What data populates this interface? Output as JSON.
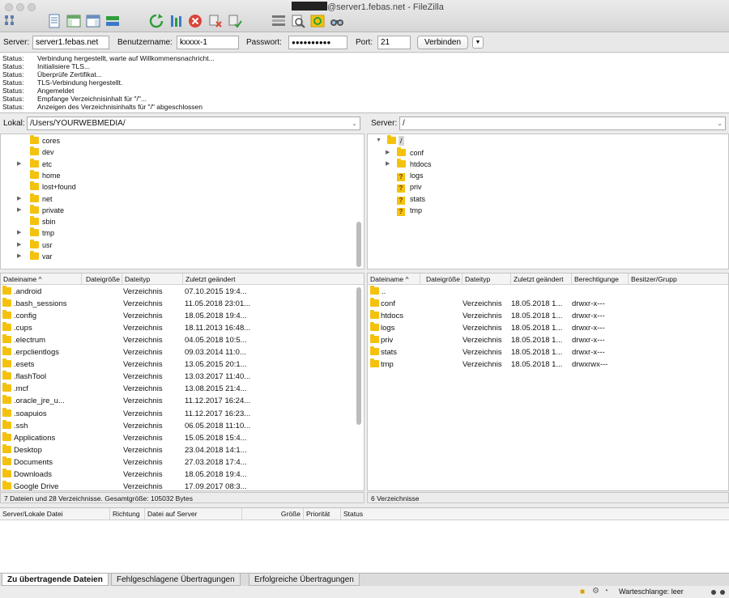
{
  "window": {
    "title_suffix": "@server1.febas.net - FileZilla"
  },
  "quickconnect": {
    "server_label": "Server:",
    "server_value": "server1.febas.net",
    "user_label": "Benutzername:",
    "user_value": "kxxxx-1",
    "pass_label": "Passwort:",
    "pass_value": "●●●●●●●●●●",
    "port_label": "Port:",
    "port_value": "21",
    "connect_label": "Verbinden",
    "dropdown_glyph": "▼"
  },
  "log": [
    {
      "key": "Status:",
      "msg": "Verbindung hergestellt, warte auf Willkommensnachricht..."
    },
    {
      "key": "Status:",
      "msg": "Initialisiere TLS..."
    },
    {
      "key": "Status:",
      "msg": "Überprüfe Zertifikat..."
    },
    {
      "key": "Status:",
      "msg": "TLS-Verbindung hergestellt."
    },
    {
      "key": "Status:",
      "msg": "Angemeldet"
    },
    {
      "key": "Status:",
      "msg": "Empfange Verzeichnisinhalt für \"/\"..."
    },
    {
      "key": "Status:",
      "msg": "Anzeigen des Verzeichnisinhalts für \"/\" abgeschlossen"
    }
  ],
  "local": {
    "path_label": "Lokal:",
    "path_value": "/Users/YOURWEBMEDIA/",
    "tree": [
      {
        "name": "cores",
        "arrow": false
      },
      {
        "name": "dev",
        "arrow": false
      },
      {
        "name": "etc",
        "arrow": true
      },
      {
        "name": "home",
        "arrow": false
      },
      {
        "name": "lost+found",
        "arrow": false
      },
      {
        "name": "net",
        "arrow": true
      },
      {
        "name": "private",
        "arrow": true
      },
      {
        "name": "sbin",
        "arrow": false
      },
      {
        "name": "tmp",
        "arrow": true
      },
      {
        "name": "usr",
        "arrow": true
      },
      {
        "name": "var",
        "arrow": true
      }
    ],
    "columns": [
      "Dateiname",
      "Dateigröße",
      "Dateityp",
      "Zuletzt geändert"
    ],
    "sort_glyph": "^",
    "rows": [
      {
        "name": ".android",
        "type": "Verzeichnis",
        "date": "07.10.2015 19:4..."
      },
      {
        "name": ".bash_sessions",
        "type": "Verzeichnis",
        "date": "11.05.2018 23:01..."
      },
      {
        "name": ".config",
        "type": "Verzeichnis",
        "date": "18.05.2018 19:4..."
      },
      {
        "name": ".cups",
        "type": "Verzeichnis",
        "date": "18.11.2013 16:48..."
      },
      {
        "name": ".electrum",
        "type": "Verzeichnis",
        "date": "04.05.2018 10:5..."
      },
      {
        "name": ".erpclientlogs",
        "type": "Verzeichnis",
        "date": "09.03.2014 11:0..."
      },
      {
        "name": ".esets",
        "type": "Verzeichnis",
        "date": "13.05.2015 20:1..."
      },
      {
        "name": ".flashTool",
        "type": "Verzeichnis",
        "date": "13.03.2017 11:40..."
      },
      {
        "name": ".mcf",
        "type": "Verzeichnis",
        "date": "13.08.2015 21:4..."
      },
      {
        "name": ".oracle_jre_u...",
        "type": "Verzeichnis",
        "date": "11.12.2017 16:24..."
      },
      {
        "name": ".soapuios",
        "type": "Verzeichnis",
        "date": "11.12.2017 16:23..."
      },
      {
        "name": ".ssh",
        "type": "Verzeichnis",
        "date": "06.05.2018 11:10..."
      },
      {
        "name": "Applications",
        "type": "Verzeichnis",
        "date": "15.05.2018 15:4..."
      },
      {
        "name": "Desktop",
        "type": "Verzeichnis",
        "date": "23.04.2018 14:1..."
      },
      {
        "name": "Documents",
        "type": "Verzeichnis",
        "date": "27.03.2018 17:4..."
      },
      {
        "name": "Downloads",
        "type": "Verzeichnis",
        "date": "18.05.2018 19:4..."
      },
      {
        "name": "Google Drive",
        "type": "Verzeichnis",
        "date": "17.09.2017 08:3..."
      }
    ],
    "status": "7 Dateien und 28 Verzeichnisse. Gesamtgröße: 105032 Bytes"
  },
  "remote": {
    "path_label": "Server:",
    "path_value": "/",
    "tree_root": "/",
    "tree": [
      {
        "name": "conf",
        "arrow": true,
        "unknown": false
      },
      {
        "name": "htdocs",
        "arrow": true,
        "unknown": false
      },
      {
        "name": "logs",
        "arrow": false,
        "unknown": true
      },
      {
        "name": "priv",
        "arrow": false,
        "unknown": true
      },
      {
        "name": "stats",
        "arrow": false,
        "unknown": true
      },
      {
        "name": "tmp",
        "arrow": false,
        "unknown": true
      }
    ],
    "columns": [
      "Dateiname",
      "Dateigröße",
      "Dateityp",
      "Zuletzt geändert",
      "Berechtigunge",
      "Besitzer/Grupp"
    ],
    "sort_glyph": "^",
    "parent_row": "..",
    "rows": [
      {
        "name": "conf",
        "type": "Verzeichnis",
        "date": "18.05.2018 1...",
        "perm": "drwxr-x---"
      },
      {
        "name": "htdocs",
        "type": "Verzeichnis",
        "date": "18.05.2018 1...",
        "perm": "drwxr-x---"
      },
      {
        "name": "logs",
        "type": "Verzeichnis",
        "date": "18.05.2018 1...",
        "perm": "drwxr-x---"
      },
      {
        "name": "priv",
        "type": "Verzeichnis",
        "date": "18.05.2018 1...",
        "perm": "drwxr-x---"
      },
      {
        "name": "stats",
        "type": "Verzeichnis",
        "date": "18.05.2018 1...",
        "perm": "drwxr-x---"
      },
      {
        "name": "tmp",
        "type": "Verzeichnis",
        "date": "18.05.2018 1...",
        "perm": "drwxrwx---"
      }
    ],
    "status": "6 Verzeichnisse"
  },
  "queue": {
    "columns": [
      "Server/Lokale Datei",
      "Richtung",
      "Datei auf Server",
      "Größe",
      "Priorität",
      "Status"
    ]
  },
  "tabs": [
    "Zu übertragende Dateien",
    "Fehlgeschlagene Übertragungen",
    "Erfolgreiche Übertragungen"
  ],
  "statusbar": {
    "queue_text": "Warteschlange: leer"
  },
  "colors": {
    "folder": "#f4c20d",
    "refresh": "#2e9e3a",
    "cancel": "#d9443a"
  }
}
